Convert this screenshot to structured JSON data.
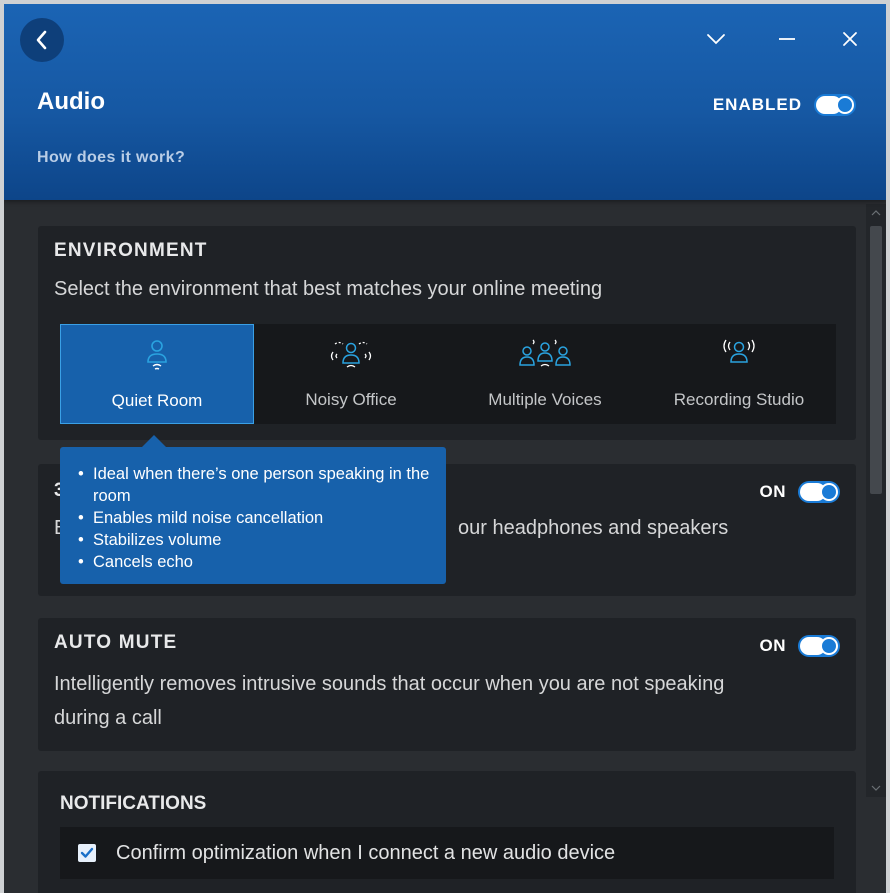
{
  "header": {
    "title": "Audio",
    "help_link": "How does it work?",
    "enabled_label": "ENABLED",
    "enabled": true
  },
  "environment": {
    "title": "ENVIRONMENT",
    "description": "Select the environment that best matches your online meeting",
    "options": [
      {
        "label": "Quiet Room",
        "icon": "person-icon",
        "selected": true
      },
      {
        "label": "Noisy Office",
        "icon": "person-noise-icon",
        "selected": false
      },
      {
        "label": "Multiple Voices",
        "icon": "group-icon",
        "selected": false
      },
      {
        "label": "Recording Studio",
        "icon": "person-broadcast-icon",
        "selected": false
      }
    ],
    "tooltip_items": [
      "Ideal when there’s one person speaking in the room",
      "Enables mild noise cancellation",
      "Stabilizes volume",
      "Cancels echo"
    ]
  },
  "spatial": {
    "title_partial": "3",
    "desc_left": "E",
    "desc_right": "our headphones and speakers",
    "on_label": "ON",
    "enabled": true
  },
  "auto_mute": {
    "title": "AUTO MUTE",
    "description": "Intelligently removes intrusive sounds that occur when you are not speaking during a call",
    "on_label": "ON",
    "enabled": true
  },
  "notifications": {
    "title": "NOTIFICATIONS",
    "confirm_label": "Confirm optimization when I connect a new audio device",
    "confirm_checked": true
  },
  "colors": {
    "header": "#1658a3",
    "accent": "#1a7bd6",
    "selected": "#1761ab",
    "icon": "#2aa3e0",
    "background": "#2a2d31",
    "card": "#1f2226"
  }
}
